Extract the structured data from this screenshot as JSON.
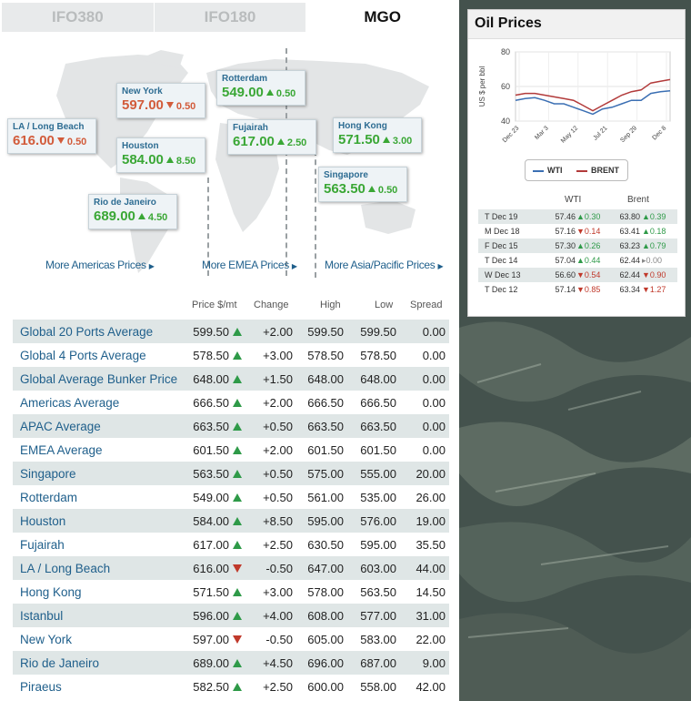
{
  "tabs": [
    "IFO380",
    "IFO180",
    "MGO"
  ],
  "map_cards": [
    {
      "city": "LA / Long Beach",
      "price": "616.00",
      "change": "0.50",
      "dir": "down"
    },
    {
      "city": "New York",
      "price": "597.00",
      "change": "0.50",
      "dir": "down"
    },
    {
      "city": "Houston",
      "price": "584.00",
      "change": "8.50",
      "dir": "up"
    },
    {
      "city": "Rio de Janeiro",
      "price": "689.00",
      "change": "4.50",
      "dir": "up"
    },
    {
      "city": "Rotterdam",
      "price": "549.00",
      "change": "0.50",
      "dir": "up"
    },
    {
      "city": "Fujairah",
      "price": "617.00",
      "change": "2.50",
      "dir": "up"
    },
    {
      "city": "Hong Kong",
      "price": "571.50",
      "change": "3.00",
      "dir": "up"
    },
    {
      "city": "Singapore",
      "price": "563.50",
      "change": "0.50",
      "dir": "up"
    }
  ],
  "links": [
    "More Americas Prices",
    "More EMEA Prices",
    "More Asia/Pacific Prices"
  ],
  "table": {
    "headers": [
      "Price $/mt",
      "Change",
      "High",
      "Low",
      "Spread"
    ],
    "rows": [
      {
        "name": "Global 20 Ports Average",
        "price": "599.50",
        "dir": "up",
        "change": "+2.00",
        "high": "599.50",
        "low": "599.50",
        "spread": "0.00"
      },
      {
        "name": "Global 4 Ports Average",
        "price": "578.50",
        "dir": "up",
        "change": "+3.00",
        "high": "578.50",
        "low": "578.50",
        "spread": "0.00"
      },
      {
        "name": "Global Average Bunker Price",
        "price": "648.00",
        "dir": "up",
        "change": "+1.50",
        "high": "648.00",
        "low": "648.00",
        "spread": "0.00"
      },
      {
        "name": "Americas Average",
        "price": "666.50",
        "dir": "up",
        "change": "+2.00",
        "high": "666.50",
        "low": "666.50",
        "spread": "0.00"
      },
      {
        "name": "APAC Average",
        "price": "663.50",
        "dir": "up",
        "change": "+0.50",
        "high": "663.50",
        "low": "663.50",
        "spread": "0.00"
      },
      {
        "name": "EMEA Average",
        "price": "601.50",
        "dir": "up",
        "change": "+2.00",
        "high": "601.50",
        "low": "601.50",
        "spread": "0.00"
      },
      {
        "name": "Singapore",
        "price": "563.50",
        "dir": "up",
        "change": "+0.50",
        "high": "575.00",
        "low": "555.00",
        "spread": "20.00"
      },
      {
        "name": "Rotterdam",
        "price": "549.00",
        "dir": "up",
        "change": "+0.50",
        "high": "561.00",
        "low": "535.00",
        "spread": "26.00"
      },
      {
        "name": "Houston",
        "price": "584.00",
        "dir": "up",
        "change": "+8.50",
        "high": "595.00",
        "low": "576.00",
        "spread": "19.00"
      },
      {
        "name": "Fujairah",
        "price": "617.00",
        "dir": "up",
        "change": "+2.50",
        "high": "630.50",
        "low": "595.00",
        "spread": "35.50"
      },
      {
        "name": "LA / Long Beach",
        "price": "616.00",
        "dir": "down",
        "change": "-0.50",
        "high": "647.00",
        "low": "603.00",
        "spread": "44.00"
      },
      {
        "name": "Hong Kong",
        "price": "571.50",
        "dir": "up",
        "change": "+3.00",
        "high": "578.00",
        "low": "563.50",
        "spread": "14.50"
      },
      {
        "name": "Istanbul",
        "price": "596.00",
        "dir": "up",
        "change": "+4.00",
        "high": "608.00",
        "low": "577.00",
        "spread": "31.00"
      },
      {
        "name": "New York",
        "price": "597.00",
        "dir": "down",
        "change": "-0.50",
        "high": "605.00",
        "low": "583.00",
        "spread": "22.00"
      },
      {
        "name": "Rio de Janeiro",
        "price": "689.00",
        "dir": "up",
        "change": "+4.50",
        "high": "696.00",
        "low": "687.00",
        "spread": "9.00"
      },
      {
        "name": "Piraeus",
        "price": "582.50",
        "dir": "up",
        "change": "+2.50",
        "high": "600.00",
        "low": "558.00",
        "spread": "42.00"
      }
    ]
  },
  "oil": {
    "title": "Oil Prices",
    "table_headers": [
      "WTI",
      "Brent"
    ],
    "rows": [
      {
        "date": "T Dec 19",
        "wti": "57.46",
        "wti_change": "0.30",
        "wti_dir": "up",
        "brent": "63.80",
        "brent_change": "0.39",
        "brent_dir": "up"
      },
      {
        "date": "M Dec 18",
        "wti": "57.16",
        "wti_change": "0.14",
        "wti_dir": "down",
        "brent": "63.41",
        "brent_change": "0.18",
        "brent_dir": "up"
      },
      {
        "date": "F Dec 15",
        "wti": "57.30",
        "wti_change": "0.26",
        "wti_dir": "up",
        "brent": "63.23",
        "brent_change": "0.79",
        "brent_dir": "up"
      },
      {
        "date": "T Dec 14",
        "wti": "57.04",
        "wti_change": "0.44",
        "wti_dir": "up",
        "brent": "62.44",
        "brent_change": "0.00",
        "brent_dir": "flat"
      },
      {
        "date": "W Dec 13",
        "wti": "56.60",
        "wti_change": "0.54",
        "wti_dir": "down",
        "brent": "62.44",
        "brent_change": "0.90",
        "brent_dir": "down"
      },
      {
        "date": "T Dec 12",
        "wti": "57.14",
        "wti_change": "0.85",
        "wti_dir": "down",
        "brent": "63.34",
        "brent_change": "1.27",
        "brent_dir": "down"
      }
    ]
  },
  "chart_data": {
    "type": "line",
    "ylabel": "US $ per bbl",
    "ylim": [
      40,
      80
    ],
    "y_ticks": [
      "40",
      "60",
      "80"
    ],
    "x_ticks": [
      "Dec 23",
      "Mar 3",
      "May 12",
      "Jul 21",
      "Sep 29",
      "Dec 8"
    ],
    "grid": true,
    "legend": "bottom",
    "x": [
      "Dec 23",
      "Jan 20",
      "Feb 17",
      "Mar 3",
      "Mar 31",
      "Apr 28",
      "May 12",
      "Jun 9",
      "Jun 23",
      "Jul 21",
      "Aug 18",
      "Sep 15",
      "Sep 29",
      "Oct 27",
      "Nov 24",
      "Dec 8",
      "Dec 19"
    ],
    "series": [
      {
        "name": "WTI",
        "color": "#3b6fb3",
        "values": [
          52,
          53,
          53.5,
          52,
          50,
          50,
          48,
          46,
          44,
          47,
          48,
          50,
          52,
          52,
          56,
          57,
          57.5
        ]
      },
      {
        "name": "BRENT",
        "color": "#b23a3a",
        "values": [
          55,
          56,
          56,
          55,
          54,
          53,
          52,
          49,
          46,
          49,
          52,
          55,
          57,
          58,
          62,
          63,
          64
        ]
      }
    ]
  }
}
